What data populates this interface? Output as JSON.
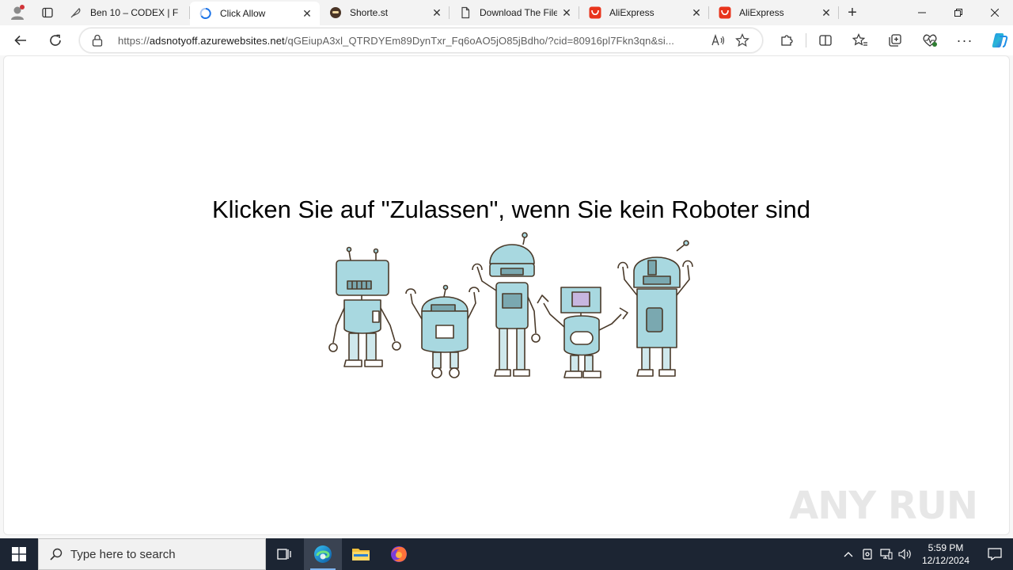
{
  "browser": {
    "tabs": [
      {
        "title": "Ben 10 – CODEX | F",
        "icon": "feather-icon",
        "active": false
      },
      {
        "title": "Click Allow",
        "icon": "loading-icon",
        "active": true
      },
      {
        "title": "Shorte.st",
        "icon": "shortest-icon",
        "active": false
      },
      {
        "title": "Download The File",
        "icon": "document-icon",
        "active": false
      },
      {
        "title": "AliExpress",
        "icon": "aliexpress-icon",
        "active": false
      },
      {
        "title": "AliExpress",
        "icon": "aliexpress-icon",
        "active": false
      }
    ],
    "address": {
      "scheme": "https://",
      "host": "adsnotyoff.azurewebsites.net",
      "path": "/qGEiupA3xl_QTRDYEm89DynTxr_Fq6oAO5jO85jBdho/?cid=80916pl7Fkn3qn&si..."
    }
  },
  "page": {
    "headline": "Klicken Sie auf \"Zulassen\", wenn Sie kein Roboter sind",
    "watermark": "ANY RUN"
  },
  "taskbar": {
    "search_placeholder": "Type here to search",
    "time": "5:59 PM",
    "date": "12/12/2024"
  },
  "colors": {
    "robot_fill": "#a8d8e0",
    "robot_stroke": "#4a3a2a",
    "taskbar_bg": "#1c2533",
    "aliexpress": "#e8341c"
  }
}
